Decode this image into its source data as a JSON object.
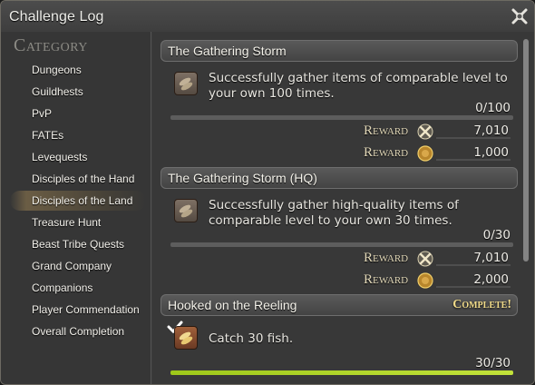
{
  "window": {
    "title": "Challenge Log"
  },
  "sidebar": {
    "heading": "Category",
    "items": [
      {
        "label": "Dungeons"
      },
      {
        "label": "Guildhests"
      },
      {
        "label": "PvP"
      },
      {
        "label": "FATEs"
      },
      {
        "label": "Levequests"
      },
      {
        "label": "Disciples of the Hand"
      },
      {
        "label": "Disciples of the Land"
      },
      {
        "label": "Treasure Hunt"
      },
      {
        "label": "Beast Tribe Quests"
      },
      {
        "label": "Grand Company"
      },
      {
        "label": "Companions"
      },
      {
        "label": "Player Commendation"
      },
      {
        "label": "Overall Completion"
      }
    ],
    "selected": "Disciples of the Land"
  },
  "entries": [
    {
      "title": "The Gathering Storm",
      "description": "Successfully gather items of comparable level to your own 100 times.",
      "progress_text": "0/100",
      "progress": 0,
      "rewards": [
        {
          "label": "Reward",
          "icon": "xp-icon",
          "value": "7,010"
        },
        {
          "label": "Reward",
          "icon": "gil-icon",
          "value": "1,000"
        }
      ]
    },
    {
      "title": "The Gathering Storm (HQ)",
      "description": "Successfully gather high-quality items of comparable level to your own 30 times.",
      "progress_text": "0/30",
      "progress": 0,
      "rewards": [
        {
          "label": "Reward",
          "icon": "xp-icon",
          "value": "7,010"
        },
        {
          "label": "Reward",
          "icon": "gil-icon",
          "value": "2,000"
        }
      ]
    },
    {
      "title": "Hooked on the Reeling",
      "status": "Complete!",
      "description": "Catch 30 fish.",
      "progress_text": "30/30",
      "progress": 1.0
    }
  ],
  "colors": {
    "progress_fill": "#b4d82a",
    "complete_text": "#f2dc8a",
    "reward_label": "#e2d8b8"
  }
}
